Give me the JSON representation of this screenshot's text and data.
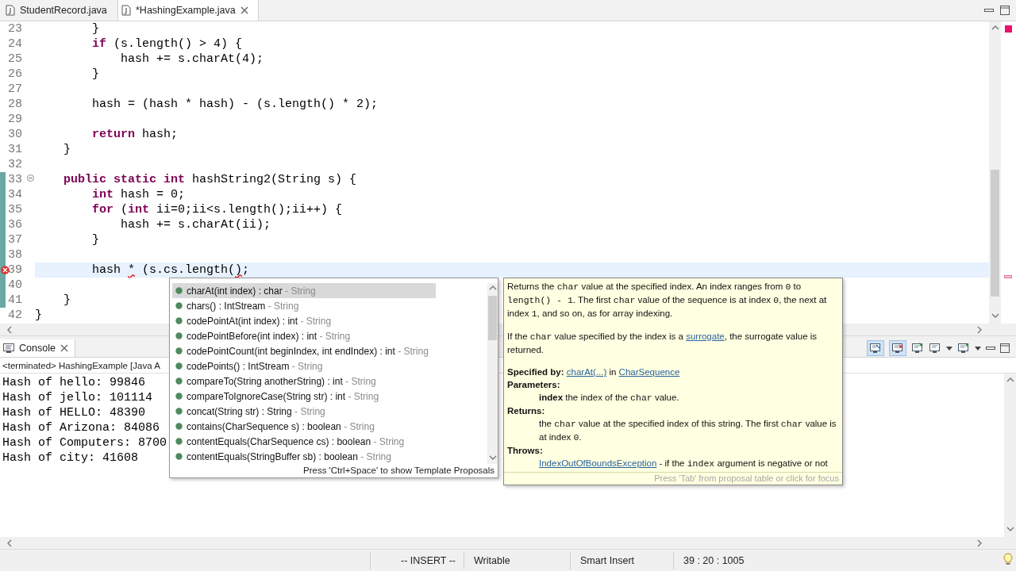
{
  "editor_tabs": [
    {
      "label": "StudentRecord.java",
      "selected": false
    },
    {
      "label": "*HashingExample.java",
      "selected": true
    }
  ],
  "editor": {
    "lines": [
      {
        "number": "23",
        "changed": false,
        "current": false,
        "error": false,
        "tokens": [
          {
            "text": "        }",
            "kind": "plain"
          }
        ]
      },
      {
        "number": "24",
        "changed": false,
        "current": false,
        "error": false,
        "tokens": [
          {
            "text": "        if",
            "kind": "keyword"
          },
          {
            "text": " (s.length() > 4) {",
            "kind": "plain"
          }
        ]
      },
      {
        "number": "25",
        "changed": false,
        "current": false,
        "error": false,
        "tokens": [
          {
            "text": "            hash += s.charAt(4);",
            "kind": "plain"
          }
        ]
      },
      {
        "number": "26",
        "changed": false,
        "current": false,
        "error": false,
        "tokens": [
          {
            "text": "        }",
            "kind": "plain"
          }
        ]
      },
      {
        "number": "27",
        "changed": false,
        "current": false,
        "error": false
      },
      {
        "number": "28",
        "changed": false,
        "current": false,
        "error": false,
        "tokens": [
          {
            "text": "        hash = (hash * hash) - (s.length() * 2);",
            "kind": "plain"
          }
        ]
      },
      {
        "number": "29",
        "changed": false,
        "current": false,
        "error": false
      },
      {
        "number": "30",
        "changed": false,
        "current": false,
        "error": false,
        "tokens": [
          {
            "text": "        return",
            "kind": "keyword"
          },
          {
            "text": " hash;",
            "kind": "plain"
          }
        ]
      },
      {
        "number": "31",
        "changed": false,
        "current": false,
        "error": false,
        "tokens": [
          {
            "text": "    }",
            "kind": "plain"
          }
        ]
      },
      {
        "number": "32",
        "changed": false,
        "current": false,
        "error": false
      },
      {
        "number": "33",
        "changed": true,
        "current": false,
        "error": false,
        "collapsible": true,
        "tokens": [
          {
            "text": "    public static int",
            "kind": "keyword"
          },
          {
            "text": " hashString2(String s) {",
            "kind": "plain"
          }
        ]
      },
      {
        "number": "34",
        "changed": true,
        "current": false,
        "error": false,
        "tokens": [
          {
            "text": "        int",
            "kind": "keyword"
          },
          {
            "text": " hash = 0;",
            "kind": "plain"
          }
        ]
      },
      {
        "number": "35",
        "changed": true,
        "current": false,
        "error": false,
        "tokens": [
          {
            "text": "        for",
            "kind": "keyword"
          },
          {
            "text": " (",
            "kind": "plain"
          },
          {
            "text": "int",
            "kind": "keyword"
          },
          {
            "text": " ii=0;ii<s.length();ii++) {",
            "kind": "plain"
          }
        ]
      },
      {
        "number": "36",
        "changed": true,
        "current": false,
        "error": false,
        "tokens": [
          {
            "text": "            hash += s.charAt(ii);",
            "kind": "plain"
          }
        ]
      },
      {
        "number": "37",
        "changed": true,
        "current": false,
        "error": false,
        "tokens": [
          {
            "text": "        }",
            "kind": "plain"
          }
        ]
      },
      {
        "number": "38",
        "changed": true,
        "current": false,
        "error": false
      },
      {
        "number": "39",
        "changed": true,
        "current": true,
        "error": true,
        "tokens": [
          {
            "text": "        hash ",
            "kind": "plain"
          },
          {
            "text": "*",
            "kind": "error"
          },
          {
            "text": " (s.cs.length(",
            "kind": "plain"
          },
          {
            "text": ")",
            "kind": "error"
          },
          {
            "text": ";",
            "kind": "plain"
          }
        ]
      },
      {
        "number": "40",
        "changed": true,
        "current": false,
        "error": false
      },
      {
        "number": "41",
        "changed": true,
        "current": false,
        "error": false,
        "tokens": [
          {
            "text": "    }",
            "kind": "plain"
          }
        ]
      },
      {
        "number": "42",
        "changed": false,
        "current": false,
        "error": false,
        "tokens": [
          {
            "text": "}",
            "kind": "plain"
          }
        ]
      }
    ]
  },
  "completion": {
    "items": [
      {
        "signature": "charAt(int index) : char",
        "owner": "- String",
        "selected": true
      },
      {
        "signature": "chars() : IntStream",
        "owner": "- String",
        "selected": false
      },
      {
        "signature": "codePointAt(int index) : int",
        "owner": "- String",
        "selected": false
      },
      {
        "signature": "codePointBefore(int index) : int",
        "owner": "- String",
        "selected": false
      },
      {
        "signature": "codePointCount(int beginIndex, int endIndex) : int",
        "owner": "- String",
        "selected": false
      },
      {
        "signature": "codePoints() : IntStream",
        "owner": "- String",
        "selected": false
      },
      {
        "signature": "compareTo(String anotherString) : int",
        "owner": "- String",
        "selected": false
      },
      {
        "signature": "compareToIgnoreCase(String str) : int",
        "owner": "- String",
        "selected": false
      },
      {
        "signature": "concat(String str) : String",
        "owner": "- String",
        "selected": false
      },
      {
        "signature": "contains(CharSequence s) : boolean",
        "owner": "- String",
        "selected": false
      },
      {
        "signature": "contentEquals(CharSequence cs) : boolean",
        "owner": "- String",
        "selected": false
      },
      {
        "signature": "contentEquals(StringBuffer sb) : boolean",
        "owner": "- String",
        "selected": false
      }
    ],
    "footer": "Press 'Ctrl+Space' to show Template Proposals"
  },
  "javadoc": {
    "blocks": [
      {
        "kind": "para",
        "tokens": [
          {
            "kind": "text",
            "text": "Returns the "
          },
          {
            "kind": "code",
            "text": "char"
          },
          {
            "kind": "text",
            "text": " value at the specified index. An index ranges from "
          },
          {
            "kind": "code",
            "text": "0"
          },
          {
            "kind": "text",
            "text": " to "
          },
          {
            "kind": "code",
            "text": "length() - 1"
          },
          {
            "kind": "text",
            "text": ". The first "
          },
          {
            "kind": "code",
            "text": "char"
          },
          {
            "kind": "text",
            "text": " value of the sequence is at index "
          },
          {
            "kind": "code",
            "text": "0"
          },
          {
            "kind": "text",
            "text": ", the next at index "
          },
          {
            "kind": "code",
            "text": "1"
          },
          {
            "kind": "text",
            "text": ", and so on, as for array indexing."
          }
        ]
      },
      {
        "kind": "para",
        "tokens": [
          {
            "kind": "text",
            "text": "If the "
          },
          {
            "kind": "code",
            "text": "char"
          },
          {
            "kind": "text",
            "text": " value specified by the index is a "
          },
          {
            "kind": "link",
            "text": "surrogate"
          },
          {
            "kind": "text",
            "text": ", the surrogate value is returned."
          }
        ]
      },
      {
        "kind": "line",
        "tokens": [
          {
            "kind": "bold",
            "text": "Specified by: "
          },
          {
            "kind": "link",
            "text": "charAt(...)"
          },
          {
            "kind": "text",
            "text": " in "
          },
          {
            "kind": "link",
            "text": "CharSequence"
          }
        ]
      },
      {
        "kind": "heading",
        "tokens": [
          {
            "kind": "text",
            "text": "Parameters:"
          }
        ]
      },
      {
        "kind": "indent",
        "tokens": [
          {
            "kind": "bold",
            "text": "index"
          },
          {
            "kind": "text",
            "text": " the index of the "
          },
          {
            "kind": "code",
            "text": "char"
          },
          {
            "kind": "text",
            "text": " value."
          }
        ]
      },
      {
        "kind": "heading",
        "tokens": [
          {
            "kind": "text",
            "text": "Returns:"
          }
        ]
      },
      {
        "kind": "indent",
        "tokens": [
          {
            "kind": "text",
            "text": "the "
          },
          {
            "kind": "code",
            "text": "char"
          },
          {
            "kind": "text",
            "text": " value at the specified index of this string. The first "
          },
          {
            "kind": "code",
            "text": "char"
          },
          {
            "kind": "text",
            "text": " value is at index "
          },
          {
            "kind": "code",
            "text": "0"
          },
          {
            "kind": "text",
            "text": "."
          }
        ]
      },
      {
        "kind": "heading",
        "tokens": [
          {
            "kind": "text",
            "text": "Throws:"
          }
        ]
      },
      {
        "kind": "indent",
        "tokens": [
          {
            "kind": "link",
            "text": "IndexOutOfBoundsException"
          },
          {
            "kind": "text",
            "text": " - if the "
          },
          {
            "kind": "code",
            "text": "index"
          },
          {
            "kind": "text",
            "text": " argument is negative or not"
          }
        ]
      }
    ],
    "footer": "Press 'Tab' from proposal table or click for focus"
  },
  "console": {
    "tab": "Console",
    "header": "<terminated> HashingExample [Java A",
    "toggles": [
      {
        "on": true
      },
      {
        "on": true
      }
    ],
    "output": [
      "Hash of hello: 99846",
      "Hash of jello: 101114",
      "Hash of HELLO: 48390",
      "Hash of Arizona: 84086",
      "Hash of Computers: 8700",
      "Hash of city: 41608"
    ]
  },
  "status_bar": [
    "-- INSERT --",
    "Writable",
    "Smart Insert",
    "39 : 20 : 1005"
  ]
}
